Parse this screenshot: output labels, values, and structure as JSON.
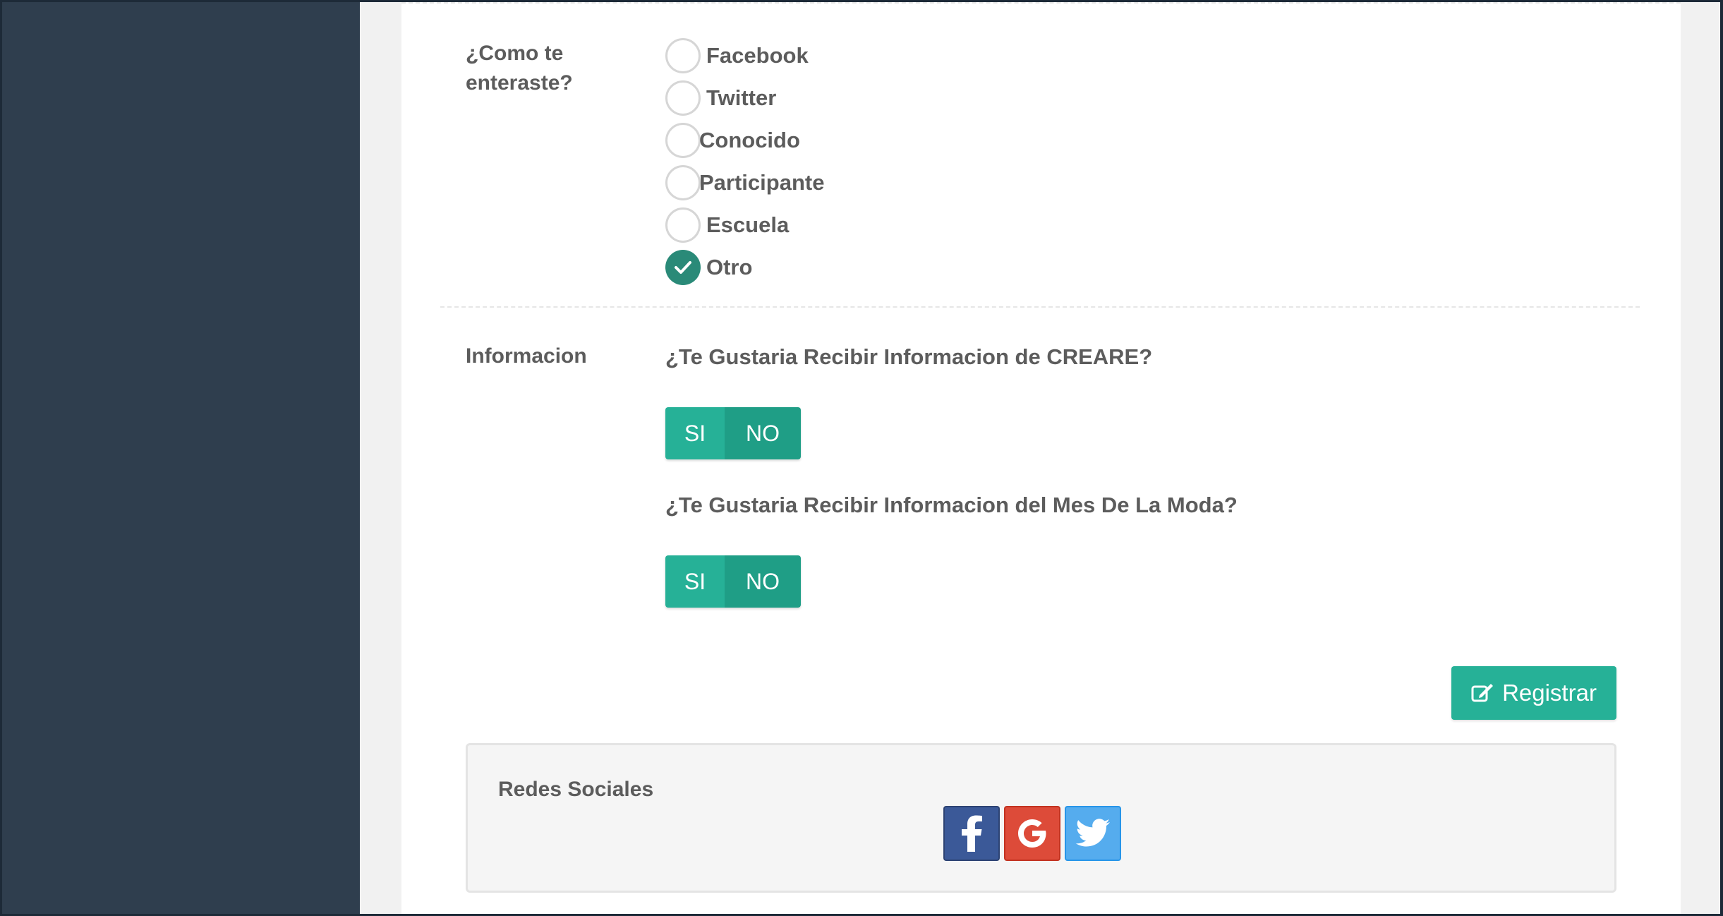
{
  "form": {
    "how_label": "¿Como te\nenteraste?",
    "how_options": [
      {
        "label": "Facebook",
        "checked": false
      },
      {
        "label": "Twitter",
        "checked": false
      },
      {
        "label": "Conocido",
        "checked": false
      },
      {
        "label": "Participante",
        "checked": false
      },
      {
        "label": "Escuela",
        "checked": false
      },
      {
        "label": "Otro",
        "checked": true
      }
    ],
    "info_label": "Informacion",
    "question_creare": "¿Te Gustaria Recibir Informacion de CREARE?",
    "question_moda": "¿Te Gustaria Recibir Informacion del Mes De La Moda?",
    "toggle_si": "SI",
    "toggle_no": "NO",
    "register_label": "Registrar"
  },
  "social": {
    "title": "Redes Sociales",
    "buttons": [
      {
        "icon": "facebook-icon",
        "color": "#3b5998"
      },
      {
        "icon": "google-icon",
        "color": "#dd4b39"
      },
      {
        "icon": "twitter-icon",
        "color": "#55acee"
      }
    ]
  },
  "colors": {
    "accent": "#26b197",
    "checked_radio": "#2a8a78",
    "sidebar": "#2f3e4e"
  }
}
